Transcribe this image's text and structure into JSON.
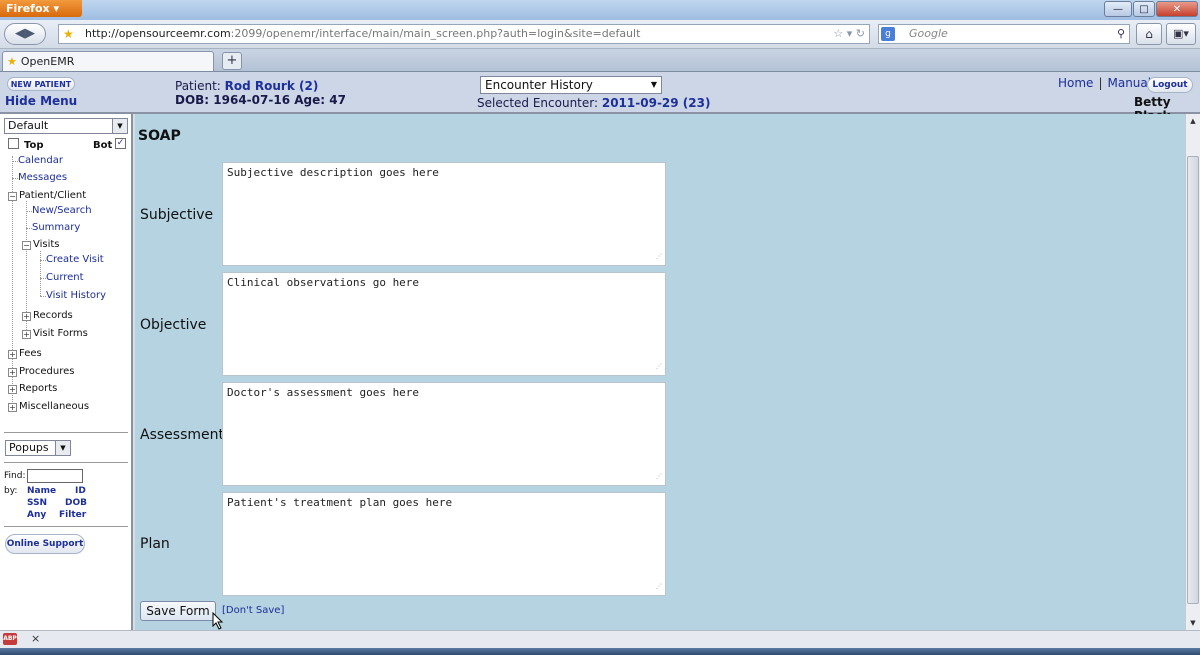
{
  "browser": {
    "app_menu": "Firefox",
    "url_host": "http://opensourceemr.com",
    "url_path": ":2099/openemr/interface/main/main_screen.php?auth=login&site=default",
    "search_placeholder": "Google",
    "tab_title": "OpenEMR",
    "new_tab_label": "+"
  },
  "header": {
    "new_patient_label": "NEW PATIENT",
    "hide_menu_label": "Hide Menu",
    "patient_prefix": "Patient:",
    "patient_name": "Rod Rourk (2)",
    "dob_line": "DOB: 1964-07-16 Age: 47",
    "encounter_dropdown": "Encounter History",
    "selected_encounter_prefix": "Selected Encounter:",
    "selected_encounter_value": "2011-09-29 (23)",
    "home_link": "Home",
    "manual_link": "Manual",
    "logout_label": "Logout",
    "user_name": "Betty Black"
  },
  "sidebar": {
    "layout_select": "Default",
    "top_label": "Top",
    "bot_label": "Bot",
    "tree": {
      "calendar": "Calendar",
      "messages": "Messages",
      "patient_client": "Patient/Client",
      "new_search": "New/Search",
      "summary": "Summary",
      "visits": "Visits",
      "create_visit": "Create Visit",
      "current": "Current",
      "visit_history": "Visit History",
      "records": "Records",
      "visit_forms": "Visit Forms",
      "fees": "Fees",
      "procedures": "Procedures",
      "reports": "Reports",
      "miscellaneous": "Miscellaneous"
    },
    "popups_select": "Popups",
    "find_label": "Find:",
    "by_label": "by:",
    "find_links": {
      "name": "Name",
      "id": "ID",
      "ssn": "SSN",
      "dob": "DOB",
      "any": "Any",
      "filter": "Filter"
    },
    "online_support_label": "Online Support"
  },
  "form": {
    "title": "SOAP",
    "subjective_label": "Subjective",
    "subjective_text": "Subjective description goes here",
    "objective_label": "Objective",
    "objective_text": "Clinical observations go here",
    "assessment_label": "Assessment",
    "assessment_text": "Doctor's assessment goes here",
    "plan_label": "Plan",
    "plan_text": "Patient's treatment plan goes here",
    "save_label": "Save Form",
    "dont_save_label": "[Don't Save]"
  },
  "statusbar": {
    "abp_label": "ABP",
    "close_glyph": "×"
  },
  "colors": {
    "link_blue": "#1d2f9a",
    "content_bg": "#b5d3e1",
    "header_bg": "#ccd6e6"
  }
}
